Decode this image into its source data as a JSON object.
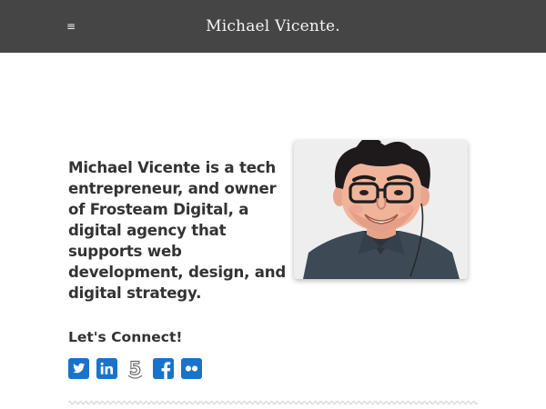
{
  "header": {
    "menu_icon": "hamburger-icon",
    "menu_glyph": "≡",
    "title": "Michael Vicente."
  },
  "main": {
    "bio": "Michael Vicente is a tech entrepreneur, and owner of Frosteam Digital, a digital agency that supports web development, design, and digital strategy.",
    "connect_heading": "Let's Connect!",
    "social_icons": [
      "twitter-icon",
      "linkedin-icon",
      "500px-icon",
      "facebook-icon",
      "flickr-icon"
    ]
  },
  "colors": {
    "header_bg": "#454545",
    "accent": "#1a73c8",
    "text": "#333333",
    "divider": "#dddddd"
  }
}
